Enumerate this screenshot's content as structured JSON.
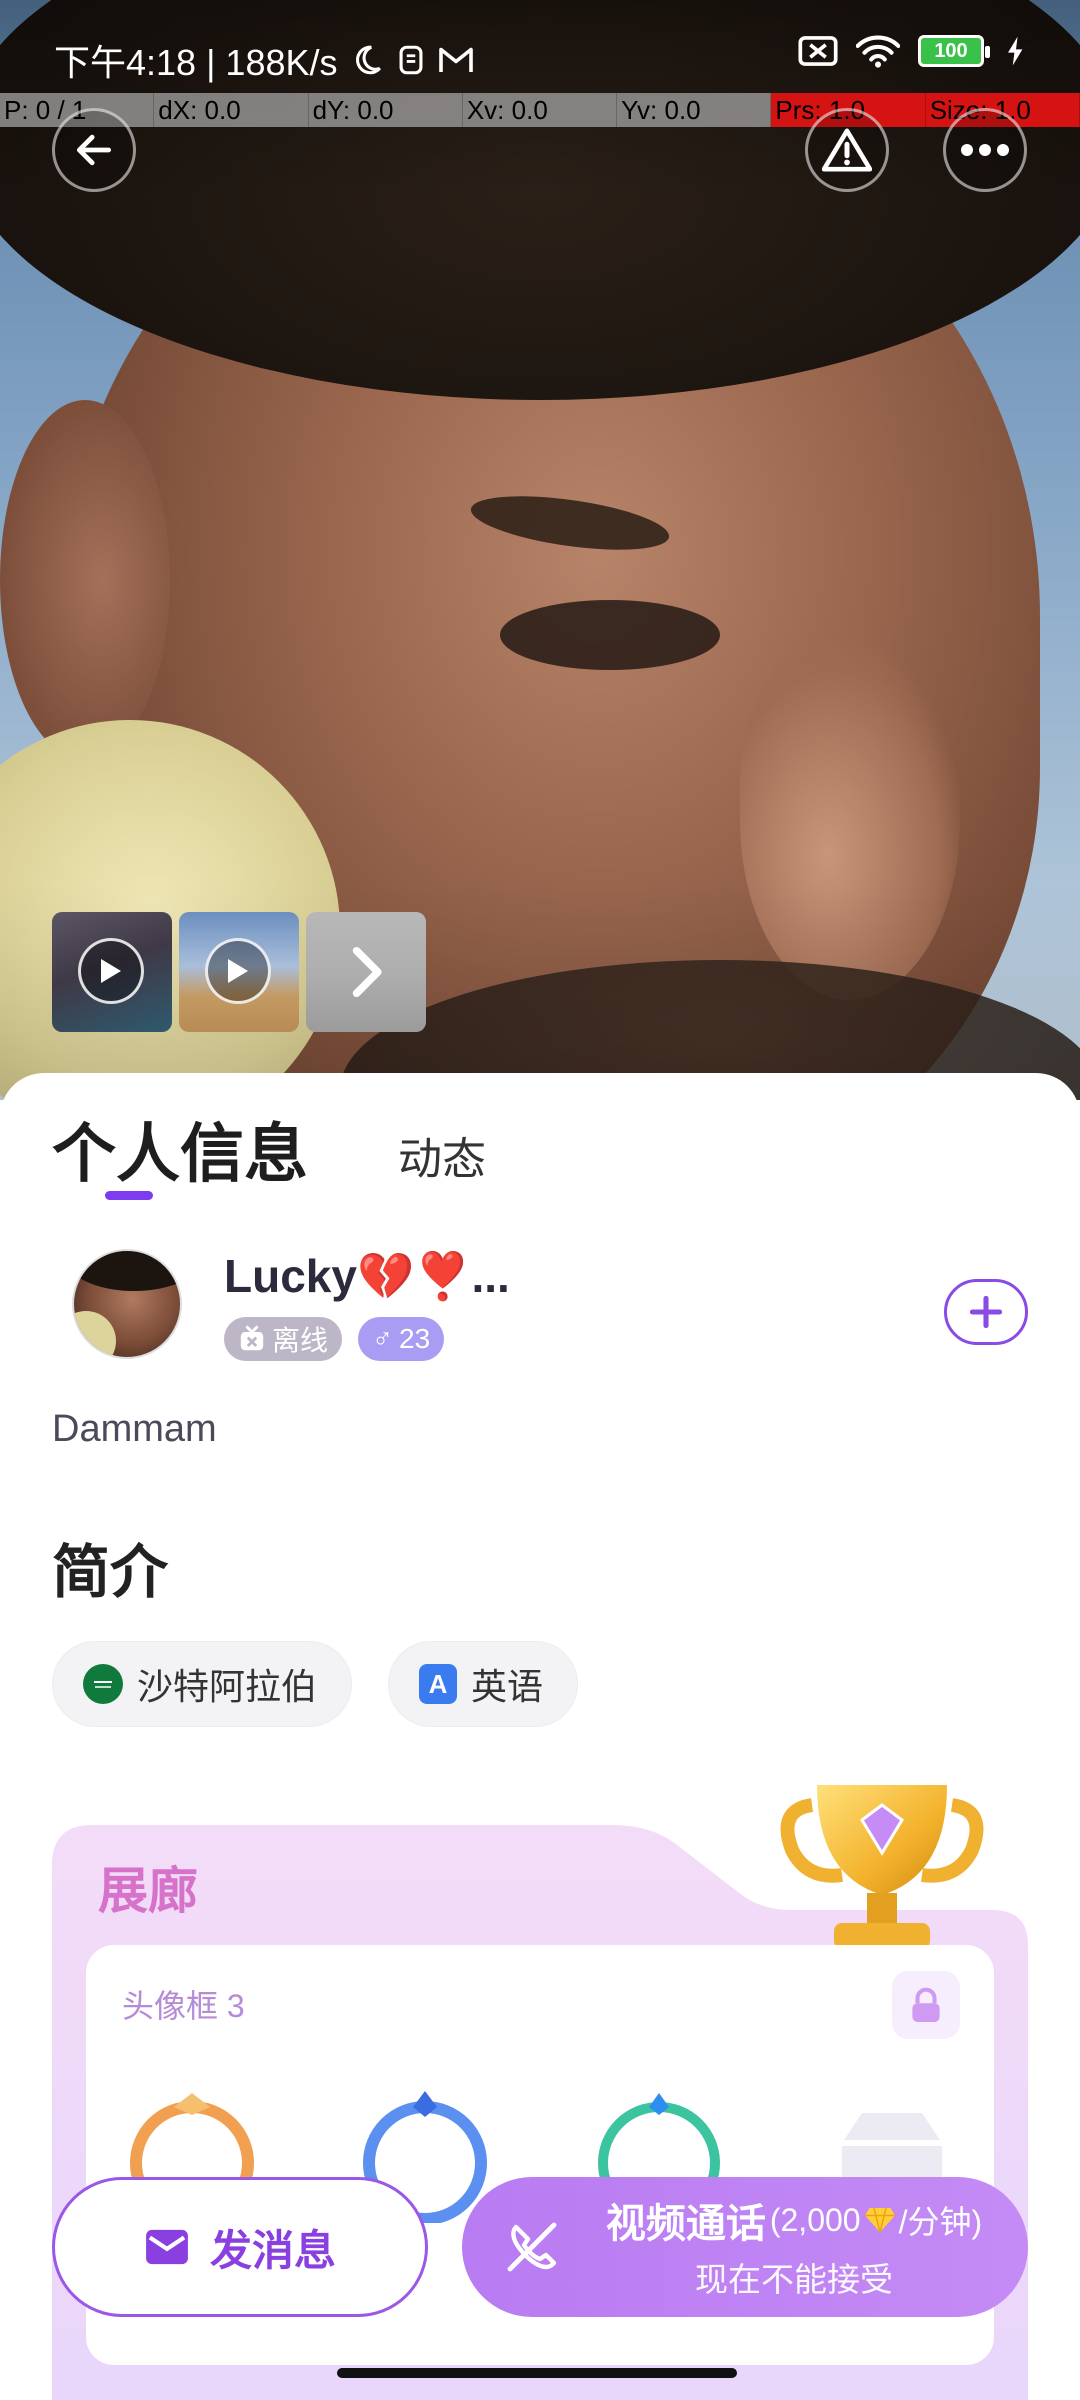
{
  "status_bar": {
    "time_speed": "下午4:18 | 188K/s",
    "battery_level": "100",
    "icons": [
      "moon-icon",
      "sim-icon",
      "gmail-icon",
      "no-sim-icon",
      "wifi-icon",
      "battery-icon",
      "charging-icon"
    ]
  },
  "debug_overlay": {
    "pointer": "P: 0 / 1",
    "dx": "dX: 0.0",
    "dy": "dY: 0.0",
    "xv": "Xv: 0.0",
    "yv": "Yv: 0.0",
    "prs": "Prs: 1.0",
    "size": "Size: 1.0"
  },
  "top_controls": {
    "icons": [
      "back-arrow-icon",
      "warning-icon",
      "more-dots-icon"
    ]
  },
  "thumbnails": [
    {
      "kind": "video",
      "icon": "play-icon"
    },
    {
      "kind": "video",
      "icon": "play-icon"
    },
    {
      "kind": "more",
      "icon": "chevron-right-icon"
    }
  ],
  "tabs": [
    {
      "label": "个人信息",
      "active": true
    },
    {
      "label": "动态",
      "active": false
    }
  ],
  "profile": {
    "name": "Lucky💔❣️...",
    "status": "离线",
    "gender_symbol": "♂",
    "age": "23",
    "city": "Dammam"
  },
  "intro": {
    "title": "简介",
    "country": "沙特阿拉伯",
    "language": "英语",
    "language_icon_letter": "A"
  },
  "gallery": {
    "title": "展廊",
    "frames_label": "头像框 3",
    "frame_colors": [
      "#f0a050",
      "#5b8ff0",
      "#3cc4a0",
      "#e9e6f0"
    ]
  },
  "actions": {
    "message_label": "发消息",
    "call_label": "视频通话",
    "call_rate": "(2,000",
    "call_rate_unit": "/分钟)",
    "call_status": "现在不能接受"
  },
  "colors": {
    "accent": "#7d3cf0",
    "call_bg": "#c08af4",
    "gallery_title": "#d672c9"
  }
}
